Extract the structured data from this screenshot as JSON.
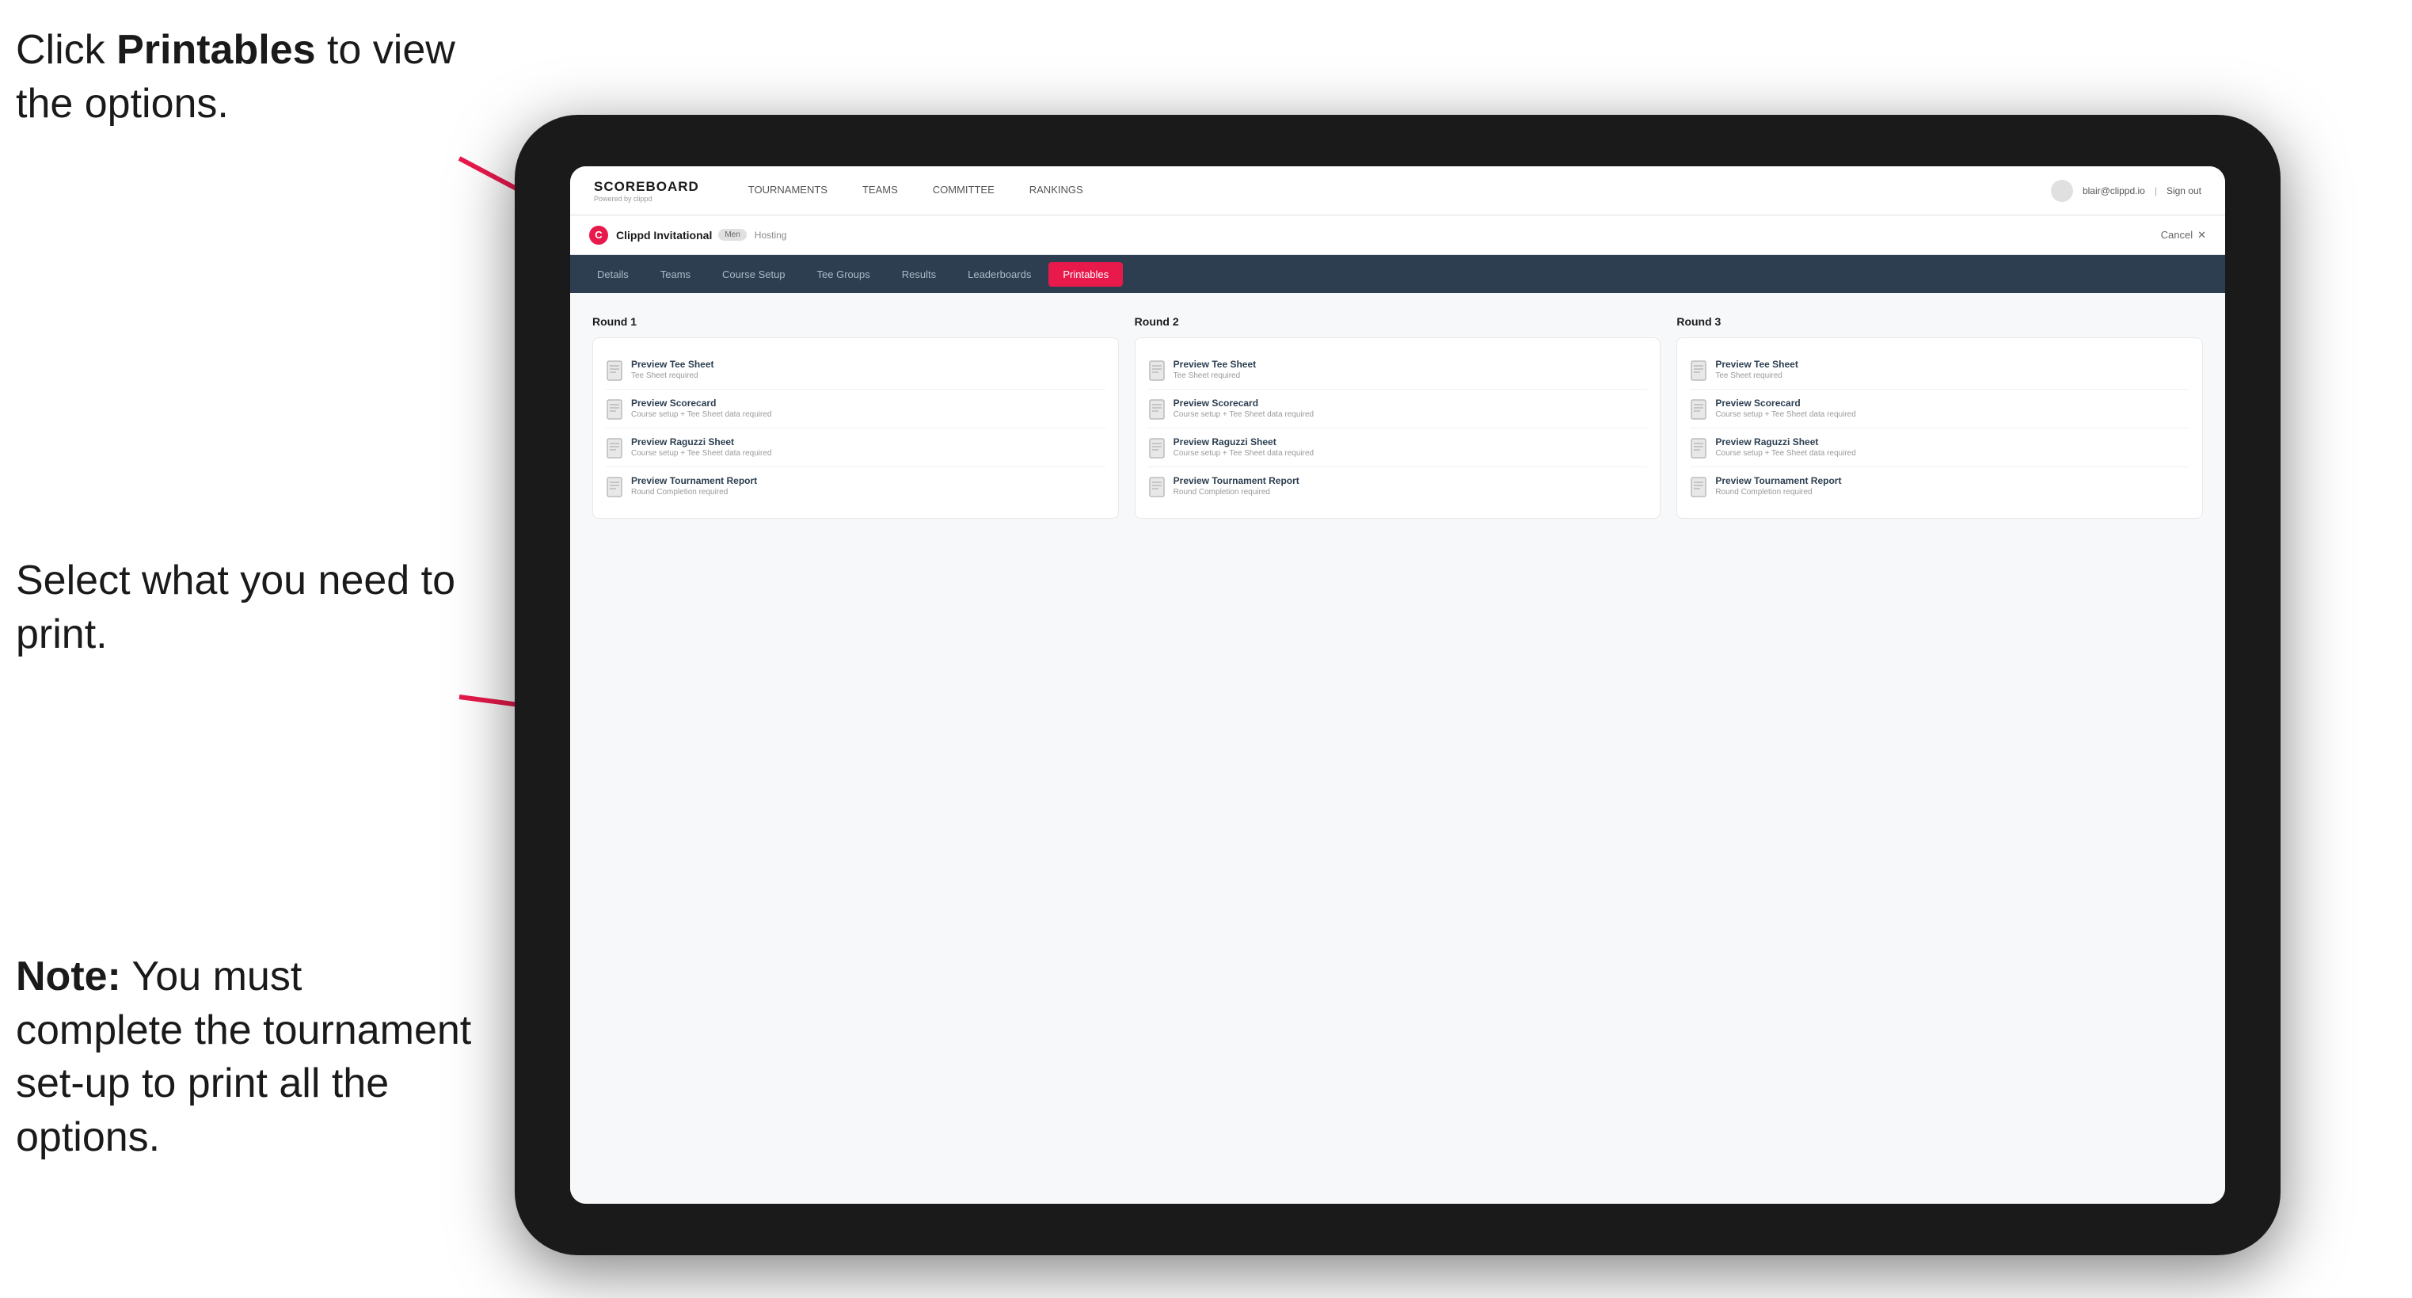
{
  "annotations": {
    "top": {
      "text_before": "Click ",
      "text_bold": "Printables",
      "text_after": " to view the options."
    },
    "middle": {
      "text": "Select what you need to print."
    },
    "bottom": {
      "text_bold": "Note:",
      "text_after": " You must complete the tournament set-up to print all the options."
    }
  },
  "nav": {
    "logo_title": "SCOREBOARD",
    "logo_subtitle": "Powered by clippd",
    "items": [
      {
        "label": "TOURNAMENTS",
        "active": false
      },
      {
        "label": "TEAMS",
        "active": false
      },
      {
        "label": "COMMITTEE",
        "active": false
      },
      {
        "label": "RANKINGS",
        "active": false
      }
    ],
    "user_email": "blair@clippd.io",
    "sign_out": "Sign out"
  },
  "tournament_bar": {
    "logo_letter": "C",
    "name": "Clippd Invitational",
    "badge": "Men",
    "status": "Hosting",
    "cancel": "Cancel",
    "close_icon": "✕"
  },
  "sub_nav": {
    "items": [
      {
        "label": "Details"
      },
      {
        "label": "Teams"
      },
      {
        "label": "Course Setup"
      },
      {
        "label": "Tee Groups"
      },
      {
        "label": "Results"
      },
      {
        "label": "Leaderboards"
      },
      {
        "label": "Printables",
        "active": true
      }
    ]
  },
  "rounds": [
    {
      "title": "Round 1",
      "items": [
        {
          "title": "Preview Tee Sheet",
          "subtitle": "Tee Sheet required"
        },
        {
          "title": "Preview Scorecard",
          "subtitle": "Course setup + Tee Sheet data required"
        },
        {
          "title": "Preview Raguzzi Sheet",
          "subtitle": "Course setup + Tee Sheet data required"
        },
        {
          "title": "Preview Tournament Report",
          "subtitle": "Round Completion required"
        }
      ]
    },
    {
      "title": "Round 2",
      "items": [
        {
          "title": "Preview Tee Sheet",
          "subtitle": "Tee Sheet required"
        },
        {
          "title": "Preview Scorecard",
          "subtitle": "Course setup + Tee Sheet data required"
        },
        {
          "title": "Preview Raguzzi Sheet",
          "subtitle": "Course setup + Tee Sheet data required"
        },
        {
          "title": "Preview Tournament Report",
          "subtitle": "Round Completion required"
        }
      ]
    },
    {
      "title": "Round 3",
      "items": [
        {
          "title": "Preview Tee Sheet",
          "subtitle": "Tee Sheet required"
        },
        {
          "title": "Preview Scorecard",
          "subtitle": "Course setup + Tee Sheet data required"
        },
        {
          "title": "Preview Raguzzi Sheet",
          "subtitle": "Course setup + Tee Sheet data required"
        },
        {
          "title": "Preview Tournament Report",
          "subtitle": "Round Completion required"
        }
      ]
    }
  ],
  "colors": {
    "accent": "#e8194b",
    "nav_bg": "#2c3e50"
  }
}
